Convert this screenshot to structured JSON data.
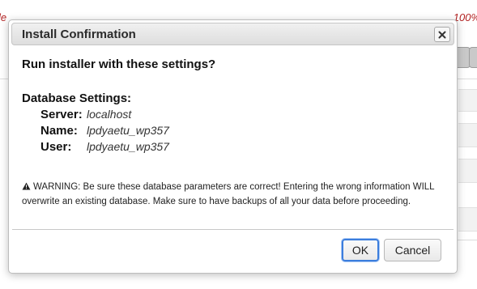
{
  "background": {
    "warning_left": "le                             ",
    "warning_right": "                                                100%"
  },
  "dialog": {
    "title": "Install Confirmation",
    "close_label": "×",
    "question": "Run installer with these settings?",
    "database": {
      "heading": "Database Settings:",
      "fields": [
        {
          "label": "Server:",
          "value": "localhost"
        },
        {
          "label": "Name:",
          "value": "lpdyaetu_wp357"
        },
        {
          "label": "User:",
          "value": "lpdyaetu_wp357"
        }
      ]
    },
    "warning": {
      "icon": "warning-triangle-icon",
      "text": "WARNING: Be sure these database parameters are correct! Entering the wrong information WILL overwrite an existing database. Make sure to have backups of all your data before proceeding."
    },
    "buttons": {
      "ok_label": "OK",
      "cancel_label": "Cancel"
    }
  },
  "colors": {
    "accent": "#3b7ddd",
    "background_warning": "#b22222"
  }
}
